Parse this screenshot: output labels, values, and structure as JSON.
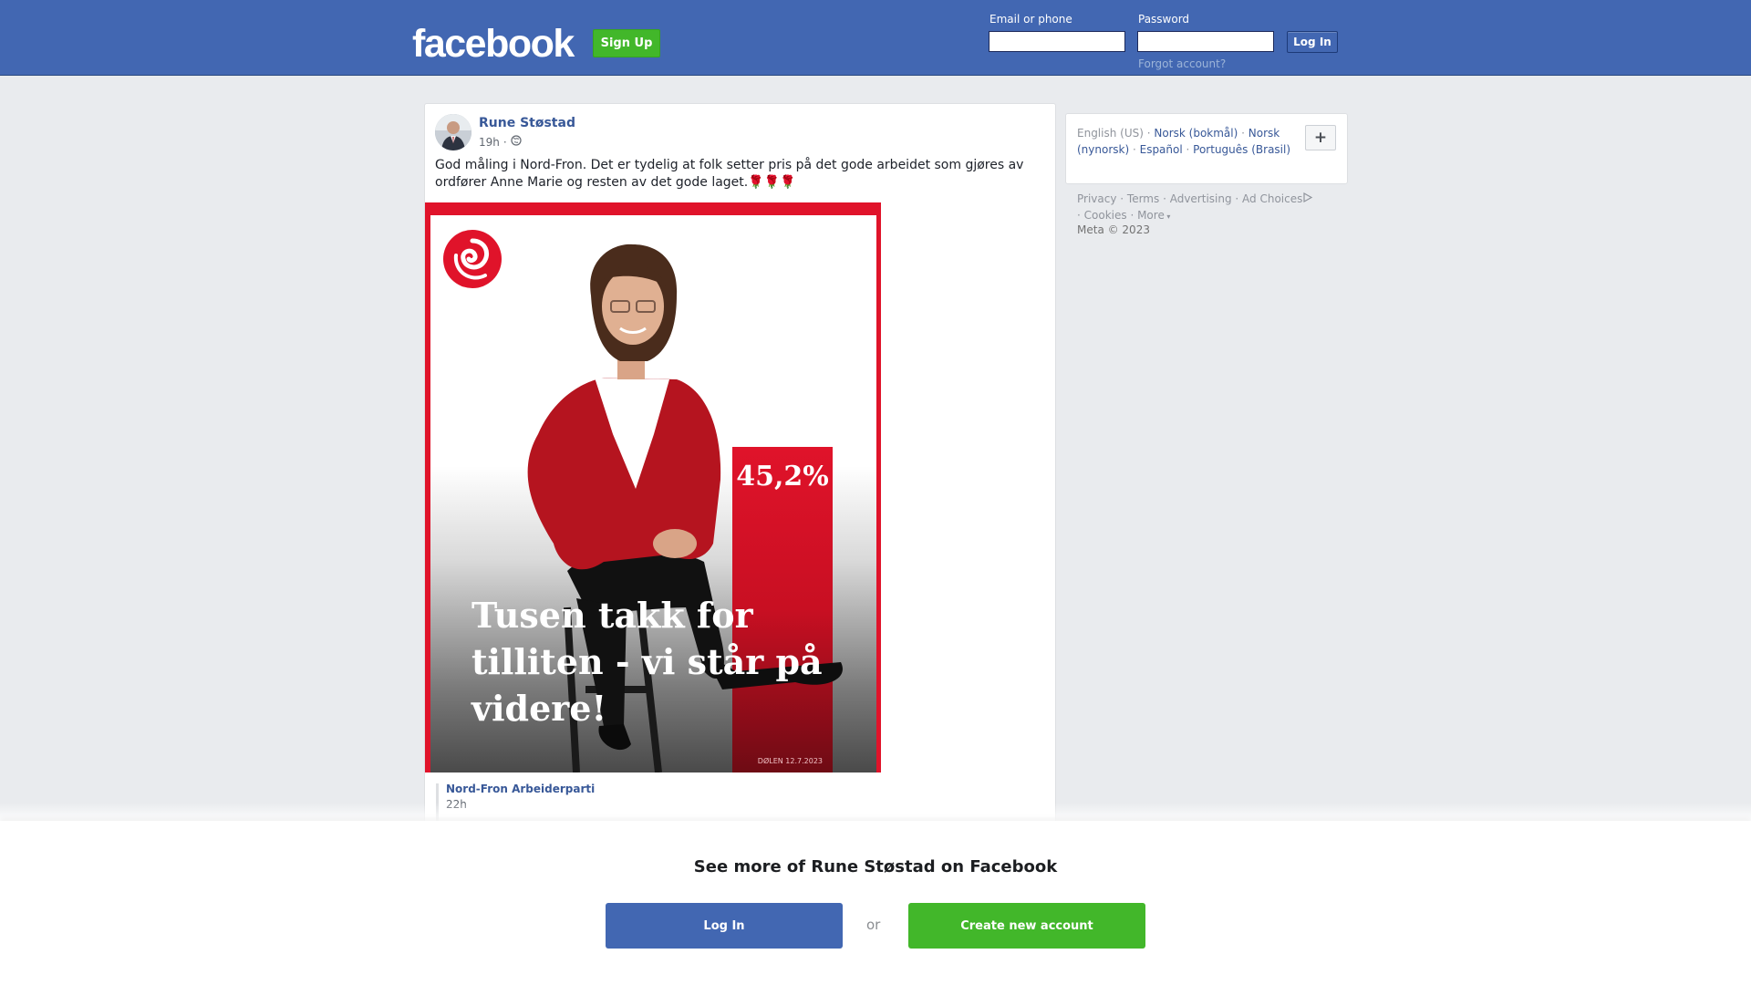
{
  "header": {
    "logo": "facebook",
    "signup_label": "Sign Up",
    "email_label": "Email or phone",
    "password_label": "Password",
    "login_label": "Log In",
    "forgot_label": "Forgot account?"
  },
  "post": {
    "author": "Rune Støstad",
    "time": "19h",
    "privacy_icon": "globe-icon",
    "text": "God måling i Nord-Fron. Det er tydelig at folk setter pris på det gode arbeidet som gjøres av ordfører Anne Marie og resten av det gode laget.🌹🌹🌹",
    "image": {
      "percent": "45,2%",
      "percent_value": 45.2,
      "headline_lines": [
        "Tusen takk for",
        "tilliten - vi står på",
        "videre!"
      ],
      "credit": "DØLEN 12.7.2023"
    },
    "shared": {
      "page": "Nord-Fron Arbeiderparti",
      "time": "22h"
    }
  },
  "languages": {
    "current": "English (US)",
    "others": [
      "Norsk (bokmål)",
      "Norsk (nynorsk)",
      "Español",
      "Português (Brasil)"
    ],
    "more_button": "+"
  },
  "footer": {
    "links": [
      "Privacy",
      "Terms",
      "Advertising",
      "Ad Choices",
      "Cookies",
      "More"
    ],
    "copyright": "Meta © 2023"
  },
  "overlay": {
    "title": "See more of Rune Støstad on Facebook",
    "login_label": "Log In",
    "or_label": "or",
    "create_label": "Create new account"
  },
  "colors": {
    "brand_blue": "#4267b2",
    "signup_green": "#42b72a",
    "party_red": "#e0132a"
  }
}
